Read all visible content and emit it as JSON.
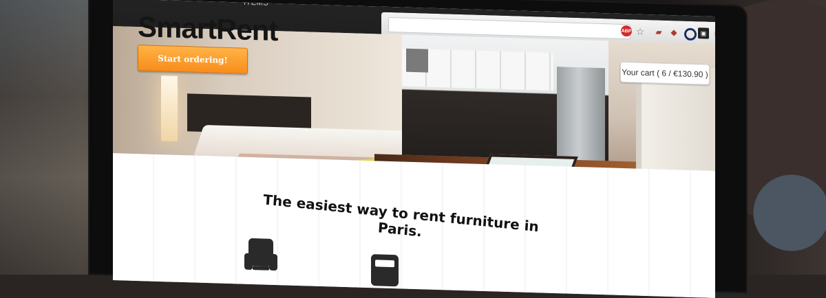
{
  "nav": {
    "items_label": "ITEMS"
  },
  "brand": {
    "name": "SmartRent"
  },
  "cta": {
    "label": "Start ordering!"
  },
  "cart": {
    "label": "Your cart ( 6 / €130.90 )"
  },
  "tagline": {
    "text": "The easiest way to rent furniture in Paris."
  },
  "browser": {
    "icons": [
      "adblock-icon",
      "star-icon",
      "extension-icon",
      "extension-icon",
      "circle-icon",
      "page-icon",
      "menu-icon"
    ],
    "abp_badge": "ABP"
  },
  "colors": {
    "cta_orange": "#f88d1b",
    "header_dark": "#1a1a1a"
  }
}
